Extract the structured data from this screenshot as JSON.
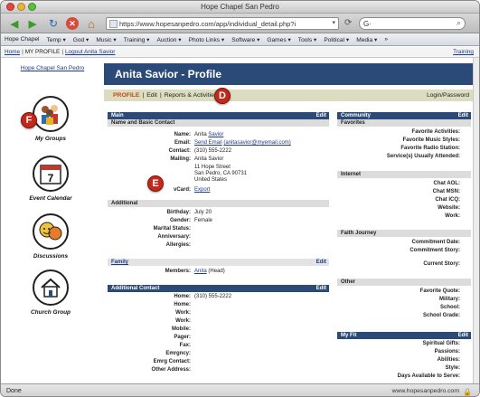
{
  "window": {
    "title": "Hope Chapel San Pedro"
  },
  "toolbar": {
    "back_glyph": "◀",
    "forward_glyph": "▶",
    "reload_glyph": "↻",
    "stop_glyph": "✕",
    "home_glyph": "⌂",
    "url": "https://www.hopesanpedro.com/app/individual_detail.php?i",
    "url_drop": "▾",
    "go_glyph": "⟳",
    "search_value": "G·",
    "search_go": "⌕"
  },
  "menu": {
    "items": [
      "Hope Chapel",
      "Temp ▾",
      "God ▾",
      "Music ▾",
      "Training ▾",
      "Auction ▾",
      "Photo Links ▾",
      "Software ▾",
      "Games ▾",
      "Tools ▾",
      "Political ▾",
      "Media ▾",
      "»"
    ]
  },
  "breadcrumb": {
    "home": "Home",
    "sep": "|",
    "my_profile": "MY PROFILE",
    "logout": "Logout Anita Savior",
    "training": "Training"
  },
  "sidebar": {
    "home_link": "Hope Chapel San Pedro",
    "tiles": [
      {
        "label": "My Groups",
        "icon": "group-icon",
        "glyph": "👥"
      },
      {
        "label": "Event Calendar",
        "icon": "calendar-icon",
        "glyph": "7"
      },
      {
        "label": "Discussions",
        "icon": "discussion-icon",
        "glyph": "💬"
      },
      {
        "label": "Church Group",
        "icon": "church-icon",
        "glyph": "⛪"
      }
    ]
  },
  "profile": {
    "heading": "Anita Savior - Profile",
    "subnav": {
      "profile": "PROFILE",
      "edit": "Edit",
      "reports": "Reports & Activities",
      "login": "Login/Password",
      "sep": "|"
    }
  },
  "main_section": {
    "title": "Main",
    "edit": "Edit",
    "sub_title": "Name and Basic Contact",
    "rows": [
      {
        "label": "Name:",
        "value": "Anita",
        "link": "Savior"
      },
      {
        "label": "Email:",
        "value": "",
        "link": "Send Email",
        "extra": "(anitasavior@myemail.com)"
      },
      {
        "label": "Contact:",
        "value": "(310) 555-2222"
      },
      {
        "label": "Mailing:",
        "value": "Anita Savior"
      }
    ],
    "address_lines": [
      "11 Hope Street",
      "San Pedro, CA 90731",
      "United States"
    ],
    "vcard_label": "vCard:",
    "vcard_link": "Export"
  },
  "additional_section": {
    "title": "Additional",
    "rows": [
      {
        "label": "Birthday:",
        "value": "July 20"
      },
      {
        "label": "Gender:",
        "value": "Female"
      },
      {
        "label": "Marital Status:",
        "value": ""
      },
      {
        "label": "Anniversary:",
        "value": ""
      },
      {
        "label": "Allergies:",
        "value": ""
      }
    ]
  },
  "family_section": {
    "title": "Family",
    "edit": "Edit",
    "members_label": "Members:",
    "member_link": "Anita",
    "member_role": "(Head)"
  },
  "additional_contact_section": {
    "title": "Additional Contact",
    "edit": "Edit",
    "rows": [
      {
        "label": "Home:",
        "value": "(310) 555-2222"
      },
      {
        "label": "Home:",
        "value": ""
      },
      {
        "label": "Work:",
        "value": ""
      },
      {
        "label": "Work:",
        "value": ""
      },
      {
        "label": "Mobile:",
        "value": ""
      },
      {
        "label": "Pager:",
        "value": ""
      },
      {
        "label": "Fax:",
        "value": ""
      },
      {
        "label": "Emrgncy:",
        "value": ""
      },
      {
        "label": "Emrg Contact:",
        "value": ""
      },
      {
        "label": "Other Address:",
        "value": ""
      }
    ]
  },
  "community_section": {
    "title": "Community",
    "edit": "Edit",
    "sub_title": "Favorites",
    "rows": [
      "Favorite Activities:",
      "Favorite Music Styles:",
      "Favorite Radio Station:",
      "Service(s) Usually Attended:"
    ]
  },
  "internet_section": {
    "title": "Internet",
    "rows": [
      "Chat AOL:",
      "Chat MSN:",
      "Chat ICQ:",
      "Website:",
      "Work:"
    ]
  },
  "faith_section": {
    "title": "Faith Journey",
    "rows": [
      "Commitment Date:",
      "Commitment Story:",
      "",
      "Current Story:"
    ]
  },
  "other_section": {
    "title": "Other",
    "rows": [
      "Favorite Quote:",
      "Military:",
      "School:",
      "School Grade:"
    ]
  },
  "myfit_section": {
    "title": "My Fit",
    "edit": "Edit",
    "rows": [
      "Spiritual Gifts:",
      "Passions:",
      "Abilities:",
      "Style:",
      "Days Available to Serve:"
    ]
  },
  "callouts": {
    "d": "D",
    "e": "E",
    "f": "F"
  },
  "status": {
    "left": "Done",
    "right": "www.hopesanpedro.com",
    "lock": "🔒"
  },
  "colors": {
    "header_blue": "#2b4a78",
    "subnav_bg": "#dcdcc0",
    "badge_red": "#c4281c",
    "link_blue": "#1a3b8a"
  }
}
